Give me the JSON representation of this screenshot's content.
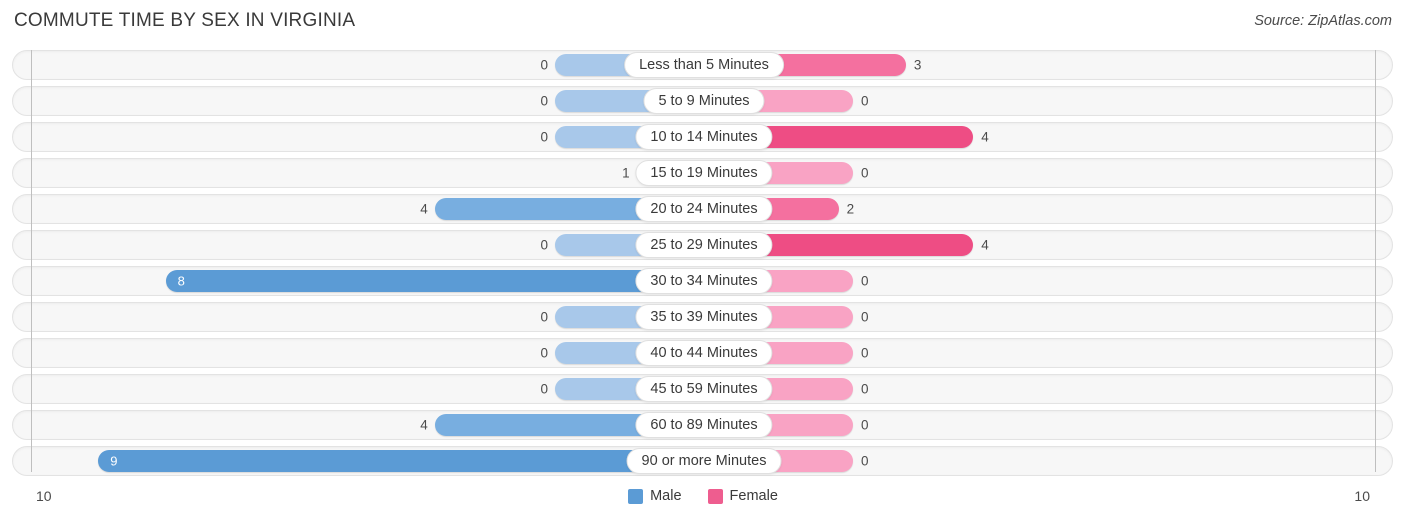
{
  "header": {
    "title": "COMMUTE TIME BY SEX IN VIRGINIA",
    "source": "Source: ZipAtlas.com"
  },
  "axis": {
    "left_tick": "10",
    "right_tick": "10"
  },
  "legend": {
    "items": [
      {
        "label": "Male",
        "color": "#5b9bd5"
      },
      {
        "label": "Female",
        "color": "#ee5d8f"
      }
    ]
  },
  "chart_data": {
    "type": "bar",
    "orientation": "horizontal-diverging",
    "title": "COMMUTE TIME BY SEX IN VIRGINIA",
    "xlabel": "",
    "ylabel": "",
    "xlim": [
      10,
      10
    ],
    "grid": false,
    "legend_position": "bottom-center",
    "categories": [
      "Less than 5 Minutes",
      "5 to 9 Minutes",
      "10 to 14 Minutes",
      "15 to 19 Minutes",
      "20 to 24 Minutes",
      "25 to 29 Minutes",
      "30 to 34 Minutes",
      "35 to 39 Minutes",
      "40 to 44 Minutes",
      "45 to 59 Minutes",
      "60 to 89 Minutes",
      "90 or more Minutes"
    ],
    "series": [
      {
        "name": "Male",
        "values": [
          0,
          0,
          0,
          1,
          4,
          0,
          8,
          0,
          0,
          0,
          4,
          9
        ]
      },
      {
        "name": "Female",
        "values": [
          3,
          0,
          4,
          0,
          2,
          4,
          0,
          0,
          0,
          0,
          0,
          0
        ]
      }
    ]
  },
  "rows": [
    {
      "category": "Less than 5 Minutes",
      "male": "0",
      "female": "3",
      "male_color": "#a8c8ea",
      "female_color": "#f4709f",
      "male_inside": false,
      "female_inside": false
    },
    {
      "category": "5 to 9 Minutes",
      "male": "0",
      "female": "0",
      "male_color": "#a8c8ea",
      "female_color": "#f9a3c4",
      "male_inside": false,
      "female_inside": false
    },
    {
      "category": "10 to 14 Minutes",
      "male": "0",
      "female": "4",
      "male_color": "#a8c8ea",
      "female_color": "#ee4d84",
      "male_inside": false,
      "female_inside": false
    },
    {
      "category": "15 to 19 Minutes",
      "male": "1",
      "female": "0",
      "male_color": "#9fc2e8",
      "female_color": "#f9a3c4",
      "male_inside": false,
      "female_inside": false
    },
    {
      "category": "20 to 24 Minutes",
      "male": "4",
      "female": "2",
      "male_color": "#78aee0",
      "female_color": "#f4709f",
      "male_inside": false,
      "female_inside": false
    },
    {
      "category": "25 to 29 Minutes",
      "male": "0",
      "female": "4",
      "male_color": "#a8c8ea",
      "female_color": "#ee4d84",
      "male_inside": false,
      "female_inside": false
    },
    {
      "category": "30 to 34 Minutes",
      "male": "8",
      "female": "0",
      "male_color": "#5b9bd5",
      "female_color": "#f9a3c4",
      "male_inside": true,
      "female_inside": false
    },
    {
      "category": "35 to 39 Minutes",
      "male": "0",
      "female": "0",
      "male_color": "#a8c8ea",
      "female_color": "#f9a3c4",
      "male_inside": false,
      "female_inside": false
    },
    {
      "category": "40 to 44 Minutes",
      "male": "0",
      "female": "0",
      "male_color": "#a8c8ea",
      "female_color": "#f9a3c4",
      "male_inside": false,
      "female_inside": false
    },
    {
      "category": "45 to 59 Minutes",
      "male": "0",
      "female": "0",
      "male_color": "#a8c8ea",
      "female_color": "#f9a3c4",
      "male_inside": false,
      "female_inside": false
    },
    {
      "category": "60 to 89 Minutes",
      "male": "4",
      "female": "0",
      "male_color": "#78aee0",
      "female_color": "#f9a3c4",
      "male_inside": false,
      "female_inside": false
    },
    {
      "category": "90 or more Minutes",
      "male": "9",
      "female": "0",
      "male_color": "#5b9bd5",
      "female_color": "#f9a3c4",
      "male_inside": true,
      "female_inside": false
    }
  ]
}
